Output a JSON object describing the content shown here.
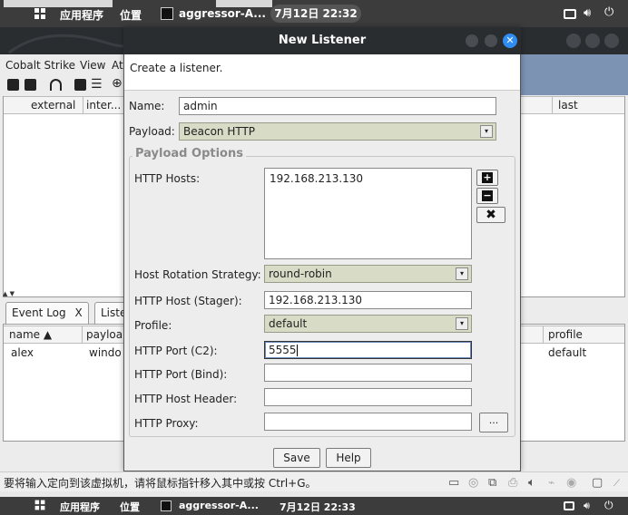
{
  "top_panel": {
    "apps_label": "应用程序",
    "places_label": "位置",
    "window_label": "aggressor-A...",
    "clock": "7月12日 22:32"
  },
  "main_window": {
    "menu": [
      "Cobalt Strike",
      "View",
      "At"
    ],
    "top_table_columns": [
      "external",
      "inter...",
      "last"
    ],
    "tabs": [
      "Event Log",
      "Liste"
    ],
    "tab_close": "X",
    "bottom_table_columns": [
      "name ▲",
      "payloa",
      "profile"
    ],
    "bottom_table_rows": [
      {
        "name": "alex",
        "payload": "windo",
        "profile": "default"
      }
    ]
  },
  "dialog": {
    "title": "New Listener",
    "description": "Create a listener.",
    "name_label": "Name:",
    "name_value": "admin",
    "payload_label": "Payload:",
    "payload_value": "Beacon HTTP",
    "group_title": "Payload Options",
    "http_hosts_label": "HTTP Hosts:",
    "http_hosts": [
      "192.168.213.130"
    ],
    "host_rotation_label": "Host Rotation Strategy:",
    "host_rotation_value": "round-robin",
    "http_host_stager_label": "HTTP Host (Stager):",
    "http_host_stager_value": "192.168.213.130",
    "profile_label": "Profile:",
    "profile_value": "default",
    "http_port_c2_label": "HTTP Port (C2):",
    "http_port_c2_value": "5555",
    "http_port_bind_label": "HTTP Port (Bind):",
    "http_port_bind_value": "",
    "http_host_header_label": "HTTP Host Header:",
    "http_host_header_value": "",
    "http_proxy_label": "HTTP Proxy:",
    "http_proxy_value": "",
    "proxy_browse_label": "...",
    "save_label": "Save",
    "help_label": "Help"
  },
  "status_bar": {
    "message": "要将输入定向到该虚拟机，请将鼠标指针移入其中或按 Ctrl+G。"
  },
  "bottom_panel": {
    "apps_label": "应用程序",
    "places_label": "位置",
    "window_label": "aggressor-A...",
    "clock": "7月12日 22:33"
  }
}
